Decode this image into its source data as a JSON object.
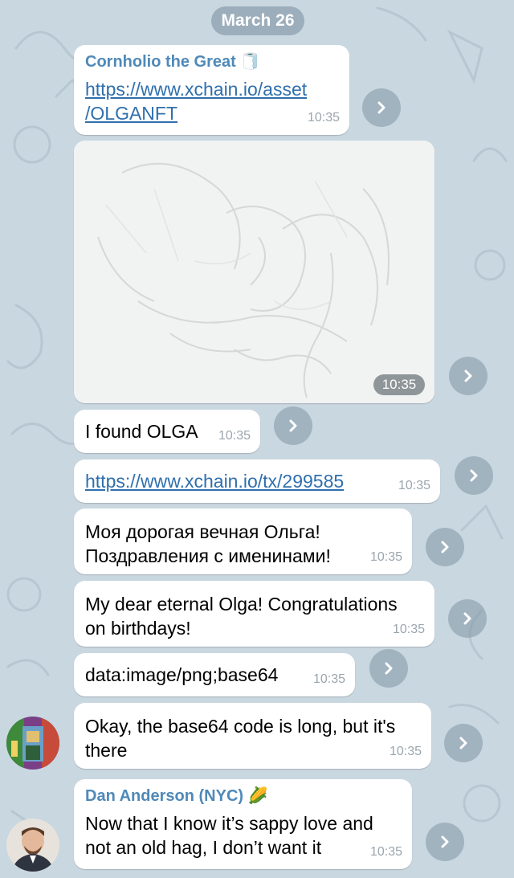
{
  "date_separator": "March 26",
  "messages": [
    {
      "sender": "Cornholio the Great",
      "sender_emoji": "🧻",
      "link_line1": "https://www.xchain.io/asset",
      "link_line2": "/OLGANFT",
      "time": "10:35"
    },
    {
      "type": "image",
      "time": "10:35"
    },
    {
      "text": "I found OLGA",
      "time": "10:35"
    },
    {
      "link": "https://www.xchain.io/tx/299585",
      "time": "10:35"
    },
    {
      "text_line1": "Моя дорогая вечная Ольга!",
      "text_line2": "Поздравления с именинами!",
      "time": "10:35"
    },
    {
      "text_line1": "My dear eternal Olga! Congratulations",
      "text_line2": "on birthdays!",
      "time": "10:35"
    },
    {
      "text": "data:image/png;base64",
      "time": "10:35"
    },
    {
      "text_line1": "Okay, the base64 code is long, but it's",
      "text_line2": "there",
      "time": "10:35"
    },
    {
      "sender": "Dan Anderson (NYC)",
      "sender_emoji": "🌽",
      "text_line1": "Now that I know it’s sappy love and",
      "text_line2": "not an old hag, I don’t want it",
      "time": "10:35"
    }
  ],
  "colors": {
    "background": "#c9d7e0",
    "bubble": "#ffffff",
    "sender_name": "#4f89b8",
    "link": "#2f6fad",
    "timestamp": "#9aa6ad"
  },
  "icons": {
    "forward": "chevron-right-icon"
  }
}
